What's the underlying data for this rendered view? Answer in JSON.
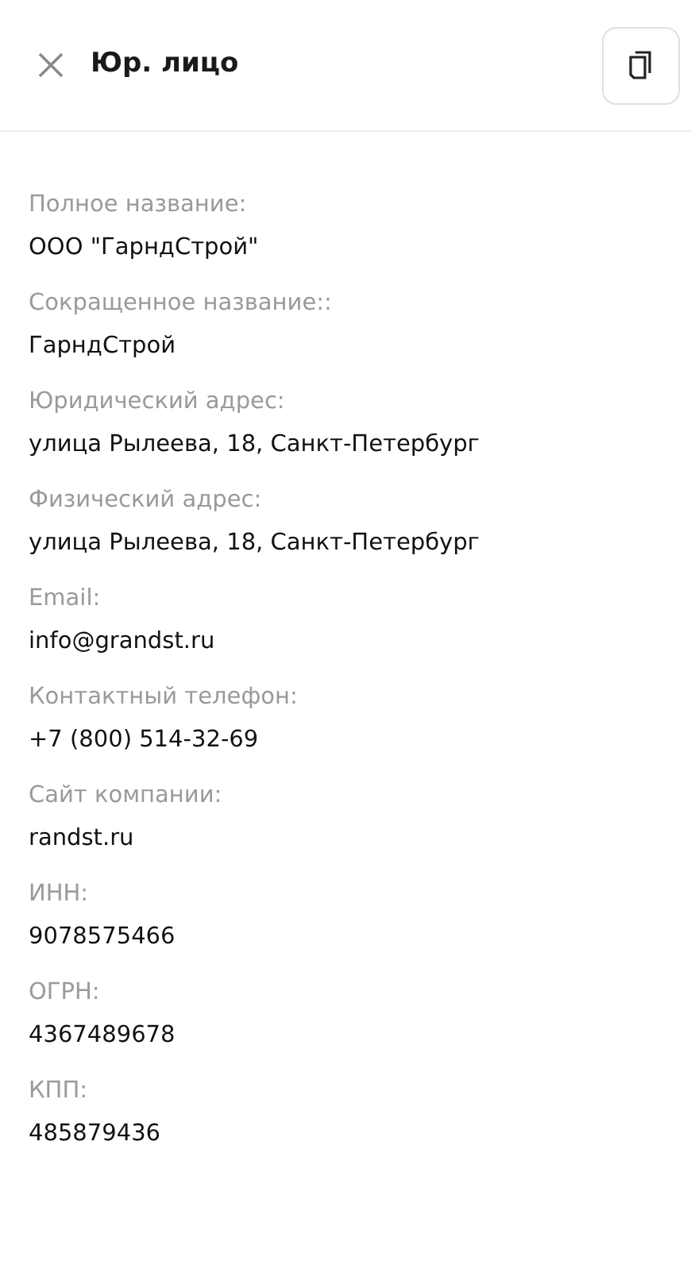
{
  "header": {
    "title": "Юр. лицо"
  },
  "fields": [
    {
      "label": "Полное название:",
      "value": "ООО \"ГарндСтрой\""
    },
    {
      "label": "Сокращенное название::",
      "value": "ГарндСтрой"
    },
    {
      "label": "Юридический адрес:",
      "value": "улица Рылеева, 18, Санкт-Петербург"
    },
    {
      "label": "Физический адрес:",
      "value": "улица Рылеева, 18, Санкт-Петербург"
    },
    {
      "label": "Email:",
      "value": "info@grandst.ru"
    },
    {
      "label": "Контактный телефон:",
      "value": "+7 (800) 514-32-69"
    },
    {
      "label": "Сайт компании:",
      "value": "randst.ru"
    },
    {
      "label": "ИНН:",
      "value": "9078575466"
    },
    {
      "label": "ОГРН:",
      "value": "4367489678"
    },
    {
      "label": "КПП:",
      "value": "485879436"
    }
  ]
}
